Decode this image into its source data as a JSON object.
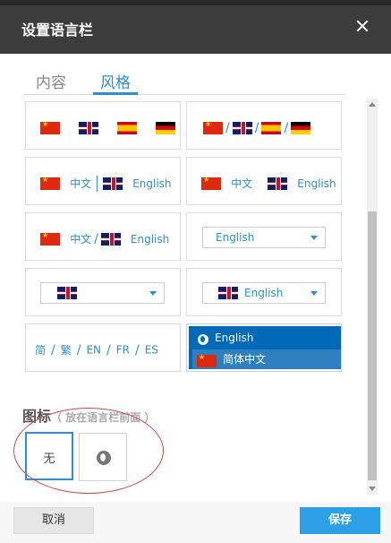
{
  "dialog": {
    "title": "设置语言栏"
  },
  "tabs": [
    {
      "label": "内容"
    },
    {
      "label": "风格"
    }
  ],
  "styles": {
    "opt3": {
      "zh": "中文",
      "en": "English"
    },
    "opt4": {
      "zh": "中文",
      "en": "English"
    },
    "opt5": {
      "zh": "中文",
      "en": "English"
    },
    "opt6": {
      "dropdown": "English"
    },
    "opt8": {
      "dropdown": "English"
    },
    "opt9": {
      "items": [
        "简",
        "繁",
        "EN",
        "FR",
        "ES"
      ]
    },
    "opt10": {
      "item1": "English",
      "item2": "简体中文"
    }
  },
  "icon_section": {
    "title": "图标",
    "note": "（ 放在语言栏前面 ）",
    "none_label": "无"
  },
  "footer": {
    "cancel": "取消",
    "save": "保存"
  },
  "colors": {
    "accent": "#2a8fd6",
    "header": "#3c3c3c",
    "save": "#2ba0e6"
  },
  "icons": [
    "close-icon",
    "globe-icon",
    "china-flag-icon",
    "uk-flag-icon",
    "spain-flag-icon",
    "germany-flag-icon"
  ]
}
